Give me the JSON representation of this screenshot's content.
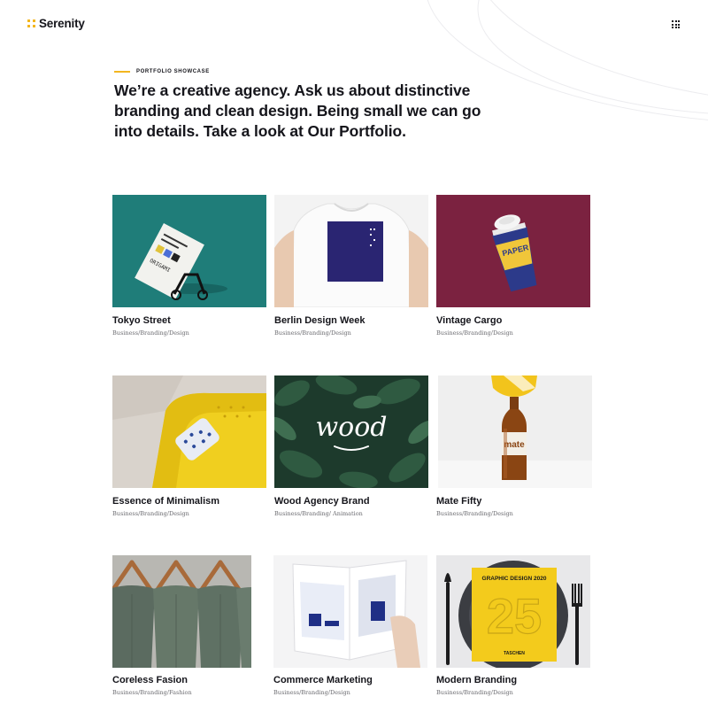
{
  "brand": {
    "name": "Serenity",
    "accent": "#f3b61f"
  },
  "header": {
    "menu_icon": "grid-menu-icon"
  },
  "intro": {
    "eyebrow": "PORTFOLIO SHOWCASE",
    "headline": "We’re a creative agency. Ask us about distinctive branding and clean design. Being small we can go into details. Take a look at Our Portfolio."
  },
  "portfolio": [
    {
      "title": "Tokyo Street",
      "category": "Business/Branding/Design",
      "image": "business-card-on-binder-clip"
    },
    {
      "title": "Berlin Design Week",
      "category": "Business/Branding/Design",
      "image": "white-tshirt-navy-print"
    },
    {
      "title": "Vintage Cargo",
      "category": "Business/Branding/Design",
      "image": "paper-coffee-cup"
    },
    {
      "title": "Essence of Minimalism",
      "category": "Business/Branding/Design",
      "image": "yellow-sofa-pillow"
    },
    {
      "title": "Wood Agency Brand",
      "category": "Business/Branding/ Animation",
      "image": "wood-lettering-leaves"
    },
    {
      "title": "Mate Fifty",
      "category": "Business/Branding/Design",
      "image": "mate-bottle"
    },
    {
      "title": "Coreless Fasion",
      "category": "Business/Branding/Fashion",
      "image": "shirts-on-hangers"
    },
    {
      "title": "Commerce Marketing",
      "category": "Business/Branding/Design",
      "image": "open-magazine"
    },
    {
      "title": "Modern Branding",
      "category": "Business/Branding/Design",
      "image": "graphic-design-book-on-plate"
    }
  ],
  "image_texts": {
    "card_sub": "ORIGAMI",
    "cup": "PAPER",
    "wood": "wood",
    "mate": "mate",
    "book": "GRAPHIC DESIGN 2020",
    "book_num": "25",
    "book_publisher": "TASCHEN"
  }
}
